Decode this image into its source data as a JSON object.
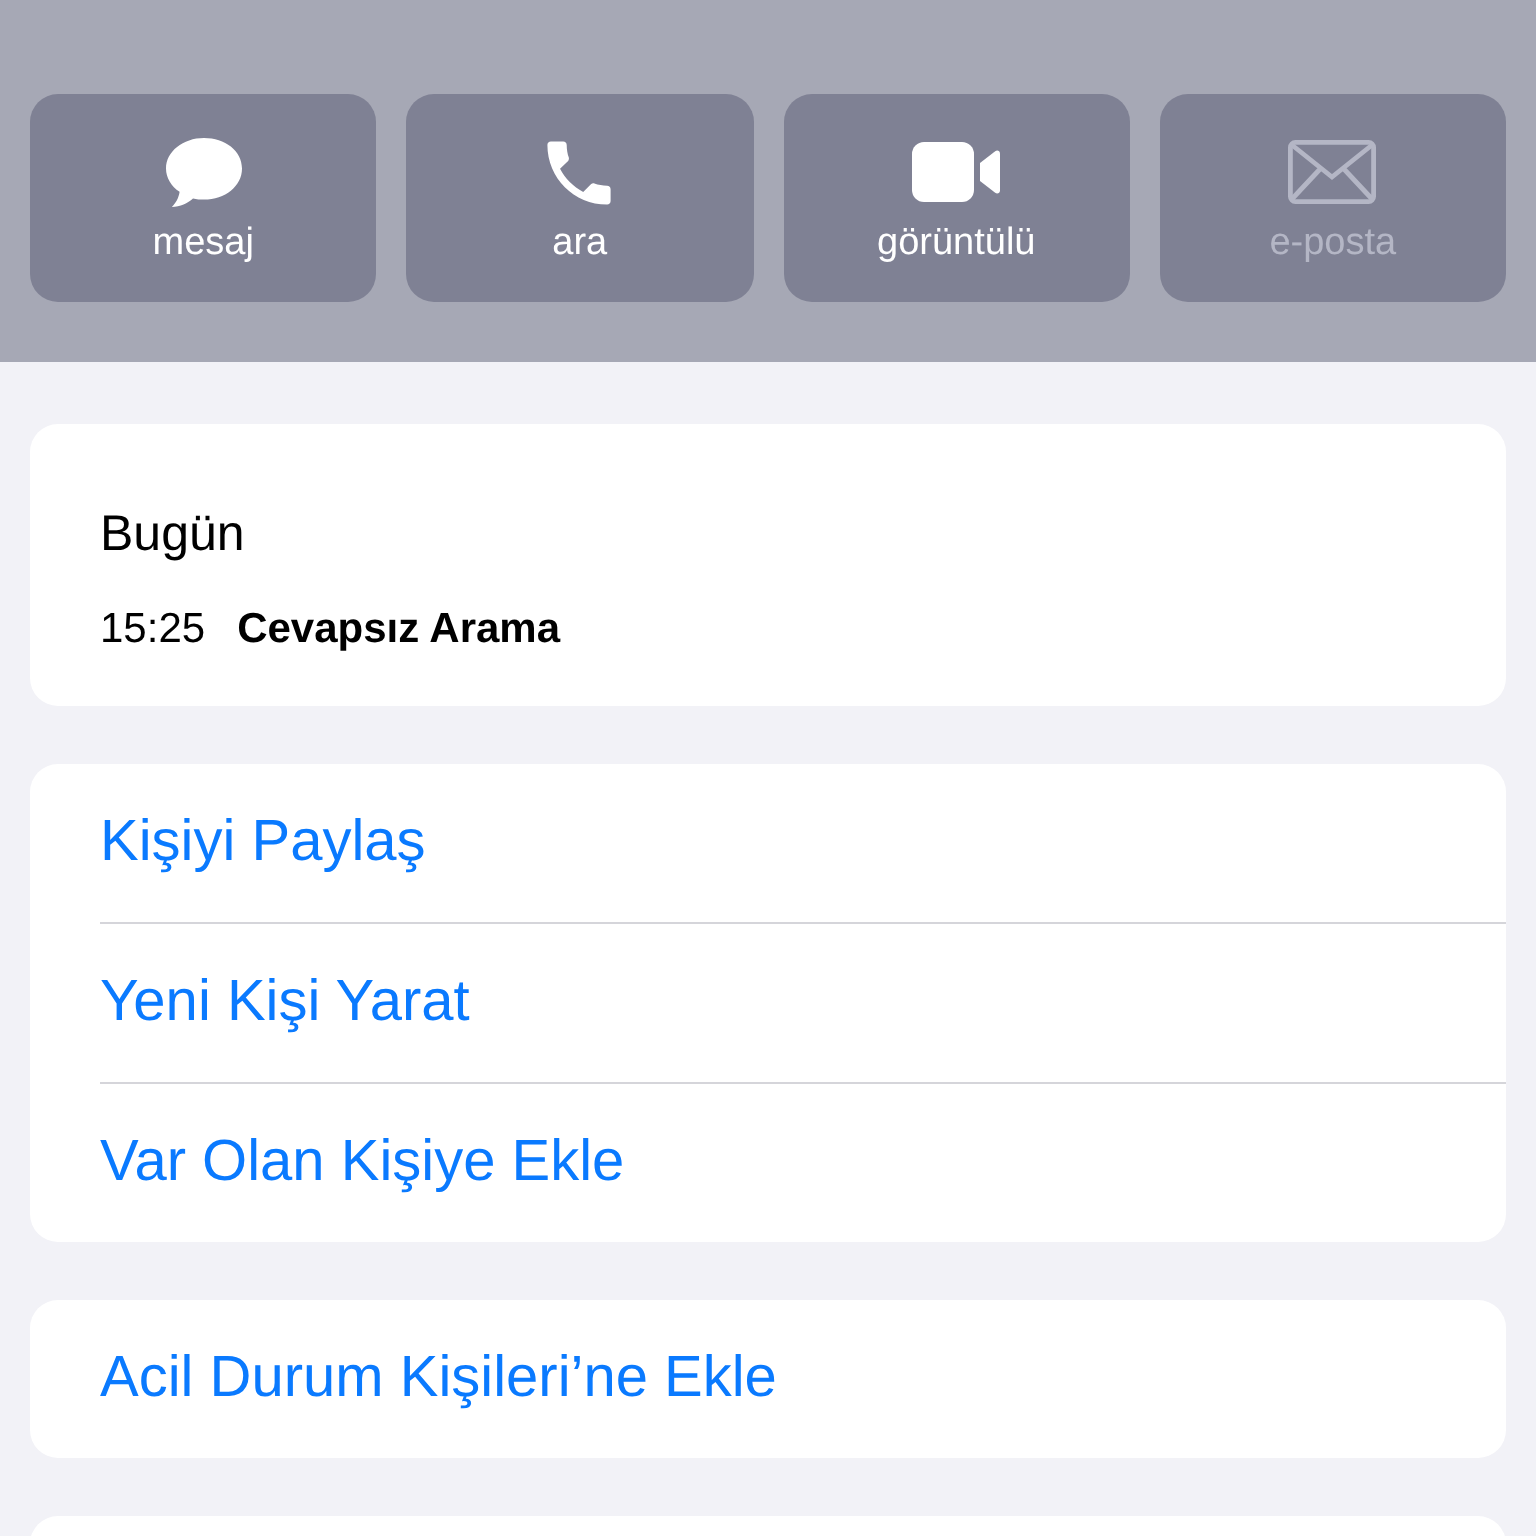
{
  "actions": [
    {
      "label": "mesaj",
      "kind": "message",
      "disabled": false
    },
    {
      "label": "ara",
      "kind": "call",
      "disabled": false
    },
    {
      "label": "görüntülü",
      "kind": "video",
      "disabled": false
    },
    {
      "label": "e-posta",
      "kind": "mail",
      "disabled": true
    }
  ],
  "recents": {
    "day": "Bugün",
    "calls": [
      {
        "time": "15:25",
        "type": "Cevapsız Arama"
      }
    ]
  },
  "groups": [
    {
      "items": [
        "Kişiyi Paylaş",
        "Yeni Kişi Yarat",
        "Var Olan Kişiye Ekle"
      ]
    },
    {
      "items": [
        "Acil Durum Kişileri’ne Ekle"
      ]
    }
  ]
}
